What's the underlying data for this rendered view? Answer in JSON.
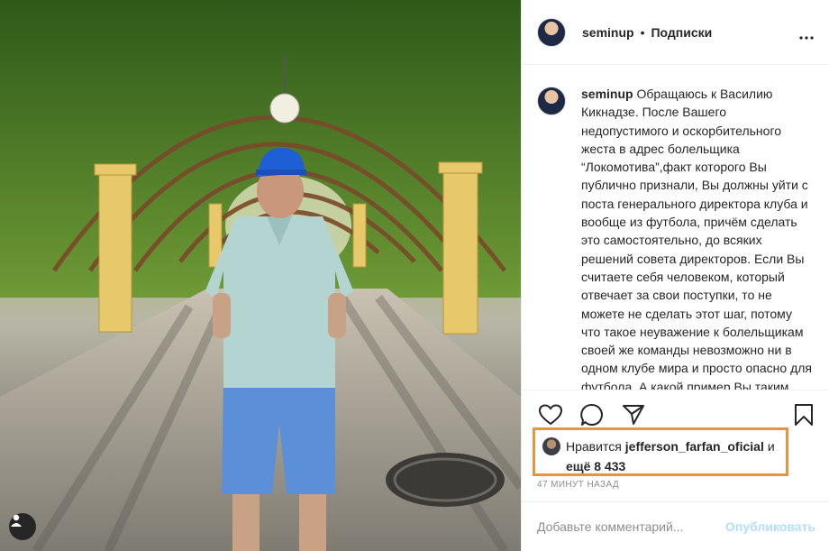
{
  "header": {
    "username": "seminup",
    "separator": "•",
    "follow_label": "Подписки",
    "more_icon": "more-horizontal-icon"
  },
  "caption": {
    "username": "seminup",
    "text": "Обращаюсь к Василию Кикнадзе. После Вашего недопустимого и оскорбительного жеста в адрес болельщика “Локомотива”,факт которого Вы публично признали, Вы должны уйти с поста генерального директора клуба и вообще из футбола, причём сделать это самостоятельно, до всяких решений совета директоров. Если Вы считаете себя человеком, который отвечает за свои поступки, то не можете не сделать этот шаг, потому что такое неуважение к болельщикам своей же команды невозможно ни в одном клубе мира и просто опасно для футбола. А какой пример Вы таким жестом"
  },
  "actions": {
    "icons": [
      "heart-icon",
      "comment-icon",
      "share-icon",
      "bookmark-icon"
    ]
  },
  "likes": {
    "prefix": "Нравится",
    "user": "jefferson_farfan_oficial",
    "conj": "и",
    "count_text": "ещё 8 433"
  },
  "timestamp": "47 МИНУТ НАЗАД",
  "comment": {
    "placeholder": "Добавьте комментарий...",
    "publish_label": "Опубликовать"
  },
  "colors": {
    "highlight_border": "#e8943a",
    "publish_disabled": "#b2dffc",
    "muted_text": "#8e8e8e"
  }
}
